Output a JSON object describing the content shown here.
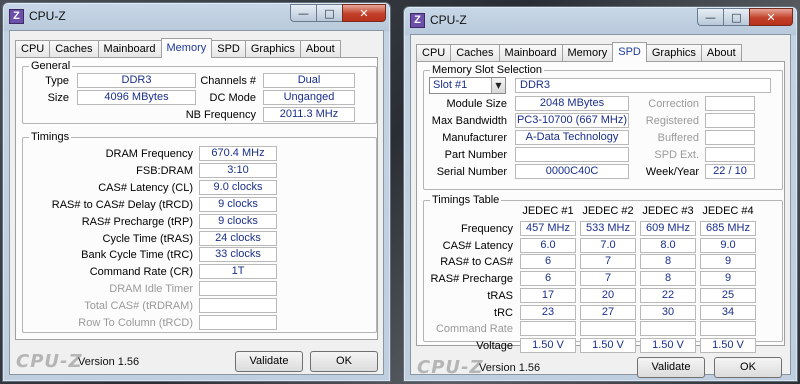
{
  "left_window": {
    "title": "CPU-Z",
    "app_icon_letter": "Z",
    "tabs": [
      "CPU",
      "Caches",
      "Mainboard",
      "Memory",
      "SPD",
      "Graphics",
      "About"
    ],
    "active_tab": "Memory",
    "general": {
      "title": "General",
      "type_label": "Type",
      "type_value": "DDR3",
      "size_label": "Size",
      "size_value": "4096 MBytes",
      "channels_label": "Channels #",
      "channels_value": "Dual",
      "dcmode_label": "DC Mode",
      "dcmode_value": "Unganged",
      "nbfreq_label": "NB Frequency",
      "nbfreq_value": "2011.3 MHz"
    },
    "timings": {
      "title": "Timings",
      "rows": [
        {
          "label": "DRAM Frequency",
          "value": "670.4 MHz",
          "dim": false
        },
        {
          "label": "FSB:DRAM",
          "value": "3:10",
          "dim": false
        },
        {
          "label": "CAS# Latency (CL)",
          "value": "9.0 clocks",
          "dim": false
        },
        {
          "label": "RAS# to CAS# Delay (tRCD)",
          "value": "9 clocks",
          "dim": false
        },
        {
          "label": "RAS# Precharge (tRP)",
          "value": "9 clocks",
          "dim": false
        },
        {
          "label": "Cycle Time (tRAS)",
          "value": "24 clocks",
          "dim": false
        },
        {
          "label": "Bank Cycle Time (tRC)",
          "value": "33 clocks",
          "dim": false
        },
        {
          "label": "Command Rate (CR)",
          "value": "1T",
          "dim": false
        },
        {
          "label": "DRAM Idle Timer",
          "value": "",
          "dim": true
        },
        {
          "label": "Total CAS# (tRDRAM)",
          "value": "",
          "dim": true
        },
        {
          "label": "Row To Column (tRCD)",
          "value": "",
          "dim": true
        }
      ]
    },
    "footer": {
      "brand": "CPU-Z",
      "version": "Version 1.56",
      "validate": "Validate",
      "ok": "OK"
    }
  },
  "right_window": {
    "title": "CPU-Z",
    "app_icon_letter": "Z",
    "tabs": [
      "CPU",
      "Caches",
      "Mainboard",
      "Memory",
      "SPD",
      "Graphics",
      "About"
    ],
    "active_tab": "SPD",
    "slot_selection": {
      "title": "Memory Slot Selection",
      "slot": "Slot #1",
      "type": "DDR3",
      "module_size_label": "Module Size",
      "module_size": "2048 MBytes",
      "max_bandwidth_label": "Max Bandwidth",
      "max_bandwidth": "PC3-10700 (667 MHz)",
      "manufacturer_label": "Manufacturer",
      "manufacturer": "A-Data Technology",
      "part_number_label": "Part Number",
      "part_number": "",
      "serial_number_label": "Serial Number",
      "serial_number": "0000C40C",
      "correction_label": "Correction",
      "correction": "",
      "registered_label": "Registered",
      "registered": "",
      "buffered_label": "Buffered",
      "buffered": "",
      "spd_ext_label": "SPD Ext.",
      "spd_ext": "",
      "week_year_label": "Week/Year",
      "week_year": "22 / 10"
    },
    "timings_table": {
      "title": "Timings Table",
      "headers": [
        "JEDEC #1",
        "JEDEC #2",
        "JEDEC #3",
        "JEDEC #4"
      ],
      "rows": [
        {
          "label": "Frequency",
          "dim": false,
          "values": [
            "457 MHz",
            "533 MHz",
            "609 MHz",
            "685 MHz"
          ]
        },
        {
          "label": "CAS# Latency",
          "dim": false,
          "values": [
            "6.0",
            "7.0",
            "8.0",
            "9.0"
          ]
        },
        {
          "label": "RAS# to CAS#",
          "dim": false,
          "values": [
            "6",
            "7",
            "8",
            "9"
          ]
        },
        {
          "label": "RAS# Precharge",
          "dim": false,
          "values": [
            "6",
            "7",
            "8",
            "9"
          ]
        },
        {
          "label": "tRAS",
          "dim": false,
          "values": [
            "17",
            "20",
            "22",
            "25"
          ]
        },
        {
          "label": "tRC",
          "dim": false,
          "values": [
            "23",
            "27",
            "30",
            "34"
          ]
        },
        {
          "label": "Command Rate",
          "dim": true,
          "values": [
            "",
            "",
            "",
            ""
          ]
        },
        {
          "label": "Voltage",
          "dim": false,
          "values": [
            "1.50 V",
            "1.50 V",
            "1.50 V",
            "1.50 V"
          ]
        }
      ]
    },
    "footer": {
      "brand": "CPU-Z",
      "version": "Version 1.56",
      "validate": "Validate",
      "ok": "OK"
    }
  },
  "colors": {
    "value_text": "#1a2f8a",
    "active_tab_text": "#1d3b9a",
    "close_button": "#c2412b",
    "app_icon": "#6b4fa8"
  }
}
